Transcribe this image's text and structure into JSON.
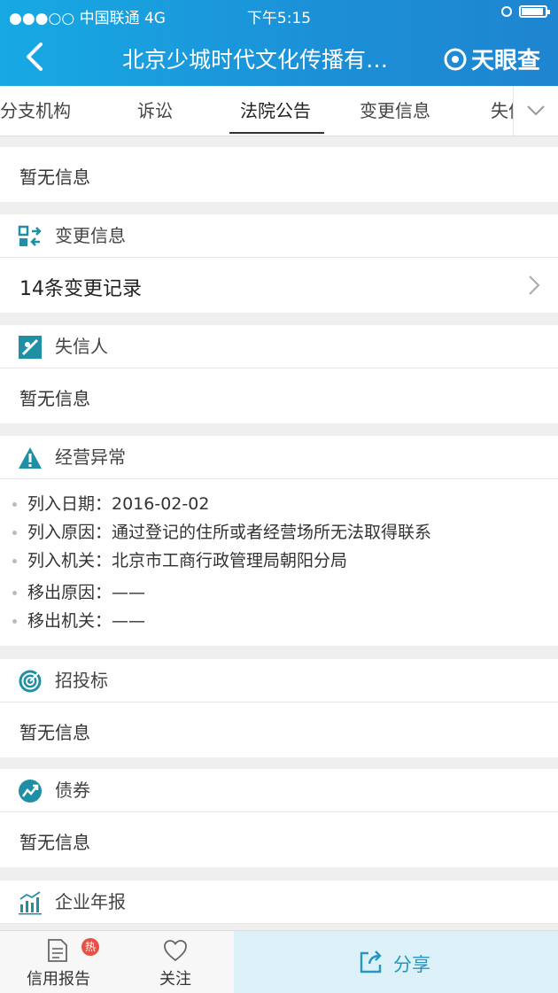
{
  "status": {
    "carrier": "●●●○○ 中国联通  4G",
    "time": "下午5:15"
  },
  "nav": {
    "title": "北京少城时代文化传播有…",
    "logo": "天眼查"
  },
  "tabs": [
    "分支机构",
    "诉讼",
    "法院公告",
    "变更信息",
    "失信"
  ],
  "top_card": {
    "text": "暂无信息"
  },
  "change": {
    "title": "变更信息",
    "row": "14条变更记录"
  },
  "dishonest": {
    "title": "失信人",
    "text": "暂无信息"
  },
  "abnormal": {
    "title": "经营异常",
    "items": [
      "列入日期：2016-02-02",
      "列入原因：通过登记的住所或者经营场所无法取得联系",
      "列入机关：北京市工商行政管理局朝阳分局",
      "移出原因：——",
      "移出机关：——"
    ]
  },
  "bidding": {
    "title": "招投标",
    "text": "暂无信息"
  },
  "bonds": {
    "title": "债券",
    "text": "暂无信息"
  },
  "annual": {
    "title": "企业年报"
  },
  "bottom": {
    "report": "信用报告",
    "hot": "热",
    "follow": "关注",
    "share": "分享"
  },
  "colors": {
    "accent": "#1a9fdc",
    "icon_teal": "#1f8fa6",
    "hot_badge": "#e65145"
  }
}
